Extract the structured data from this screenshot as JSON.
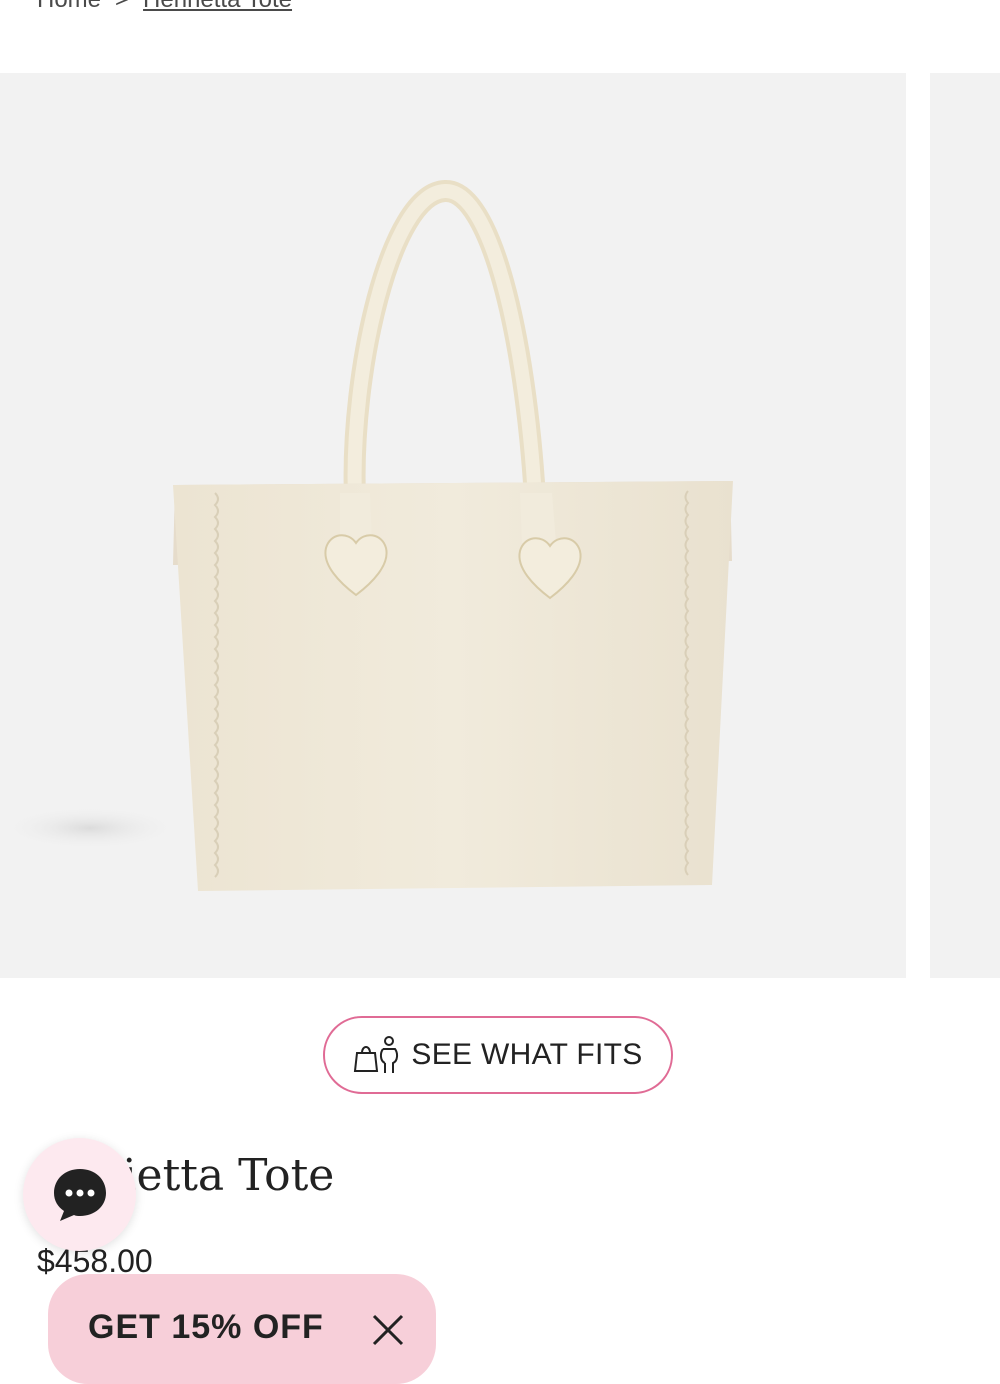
{
  "breadcrumb": {
    "home": "Home",
    "separator": ">",
    "current": "Henrietta Tote"
  },
  "product": {
    "title": "Henrietta Tote",
    "title_visible": "rietta Tote",
    "price": "$458.00"
  },
  "fit_button": {
    "label": "SEE WHAT FITS",
    "icon": "bag-person-icon"
  },
  "promo": {
    "label": "GET 15% OFF"
  },
  "chat": {
    "icon": "chat-icon"
  },
  "colors": {
    "accent": "#e06b95",
    "promo_bg": "#f7cfd9",
    "chat_bg": "#fde9ef",
    "gallery_bg": "#f2f2f2",
    "bag_color": "#efe8d8"
  }
}
